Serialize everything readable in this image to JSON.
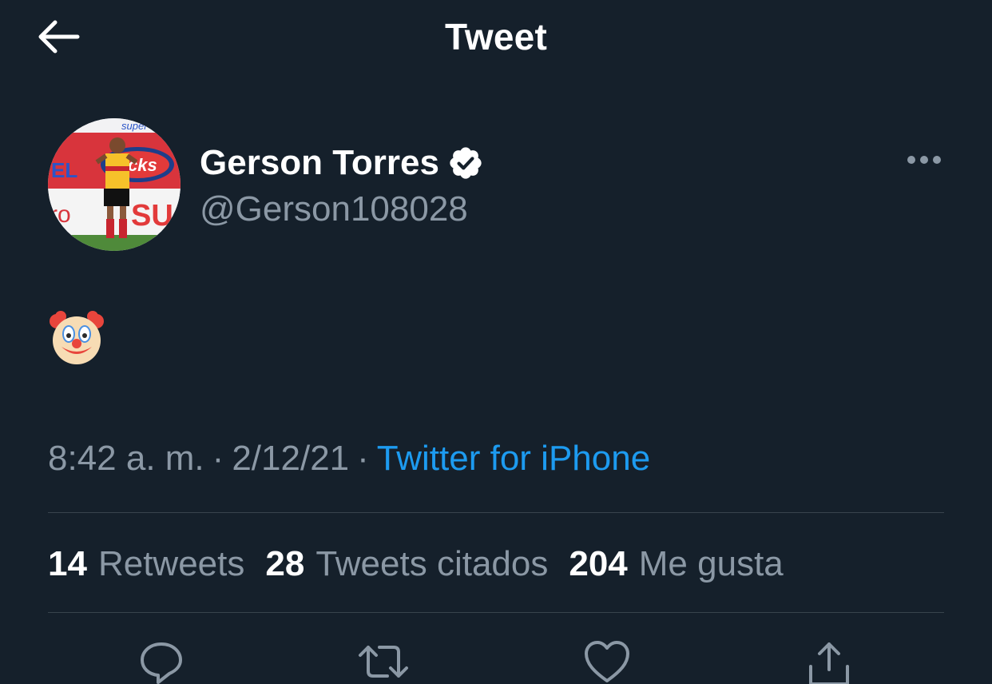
{
  "header": {
    "title": "Tweet",
    "back_icon": "arrow-left-icon"
  },
  "tweet": {
    "author": {
      "display_name": "Gerson Torres",
      "handle": "@Gerson108028",
      "verified": true,
      "avatar": "soccer-player-photo"
    },
    "body_emoji": "clown-face-emoji",
    "time": "8:42 a. m.",
    "date": "2/12/21",
    "separator": "·",
    "source": "Twitter for iPhone",
    "more_icon": "ellipsis-icon"
  },
  "stats": [
    {
      "count": "14",
      "label": "Retweets"
    },
    {
      "count": "28",
      "label": "Tweets citados"
    },
    {
      "count": "204",
      "label": "Me gusta"
    }
  ],
  "actions": [
    {
      "icon": "reply-icon"
    },
    {
      "icon": "retweet-icon"
    },
    {
      "icon": "like-heart-icon"
    },
    {
      "icon": "share-icon"
    }
  ],
  "colors": {
    "background": "#15202b",
    "text_primary": "#ffffff",
    "text_secondary": "#8b98a5",
    "accent": "#1d9bf0",
    "divider": "#38444d"
  }
}
